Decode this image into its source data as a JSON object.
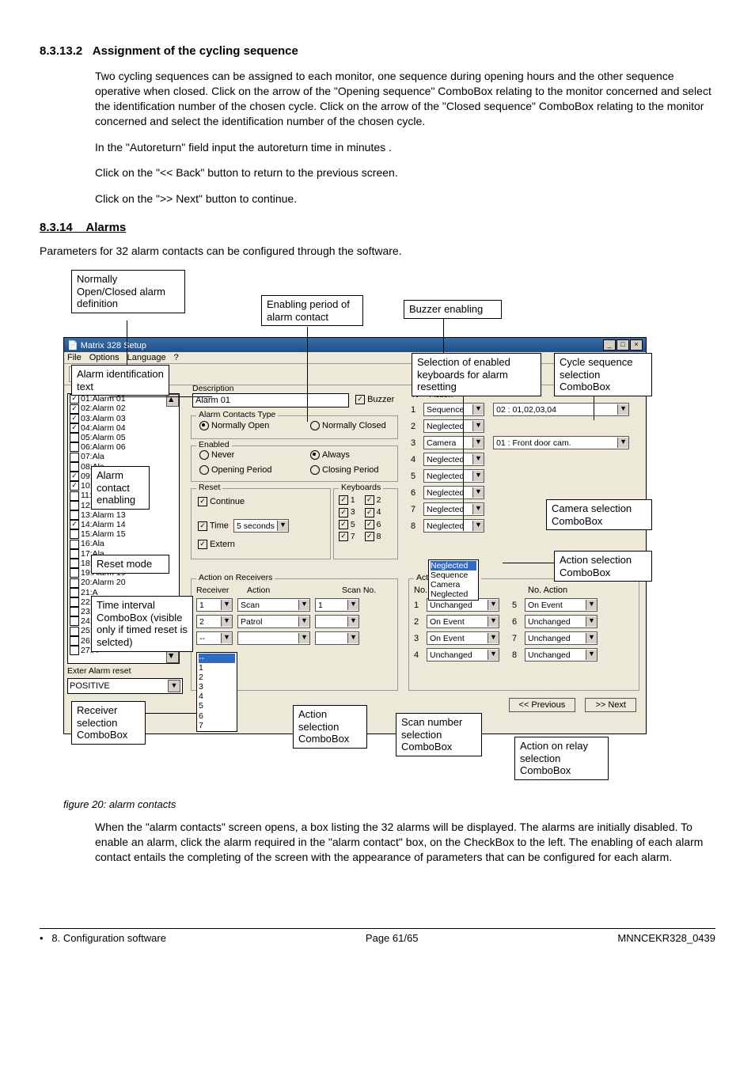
{
  "section": {
    "num1": "8.3.13.2",
    "title1": "Assignment of the cycling sequence",
    "para1": "Two cycling sequences can be assigned to each monitor, one sequence during opening hours and the other sequence operative when closed. Click on the arrow of  the \"Opening sequence\" ComboBox relating to the monitor concerned and select the identification number of the chosen cycle. Click on the arrow of the \"Closed sequence\" ComboBox relating to the monitor concerned and select the identification number of the chosen cycle.",
    "para2": "In the \"Autoreturn\" field input the autoreturn time in minutes .",
    "para3": "Click on the \"<<  Back\" button to return to the previous screen.",
    "para4": "Click on the \">>  Next\" button to continue.",
    "num2": "8.3.14",
    "title2": "Alarms",
    "para5": "Parameters for 32 alarm contacts can be configured through the software."
  },
  "callouts": {
    "c_open_closed": "Normally Open/Closed alarm definition",
    "c_enable_period": "Enabling period of alarm contact",
    "c_buzzer": "Buzzer enabling",
    "c_ident": "Alarm identification text",
    "c_kb_sel": "Selection of enabled keyboards for alarm resetting",
    "c_cycle": "Cycle sequence selection ComboBox",
    "c_alarm_enable": "Alarm contact enabling",
    "c_reset_mode": "Reset mode",
    "c_time_int": "Time interval ComboBox (visible only if timed reset is selcted)",
    "c_cam_sel": "Camera selection ComboBox",
    "c_act_sel": "Action selection ComboBox",
    "c_recv_sel": "Receiver selection ComboBox",
    "c_action_combo": "Action selection ComboBox",
    "c_scan_combo": "Scan number selection ComboBox",
    "c_relay_combo": "Action on relay selection ComboBox"
  },
  "window": {
    "title": "Matrix 328 Setup",
    "menu": [
      "File",
      "Options",
      "Language",
      "?"
    ],
    "desc_label": "Description",
    "desc_value": "Alarm 01",
    "buzzer_label": "Buzzer",
    "alarm_contacts_legend": "Alarm Contacts Type",
    "normally_open": "Normally Open",
    "normally_closed": "Normally Closed",
    "enabled_legend": "Enabled",
    "never": "Never",
    "always": "Always",
    "opening_period": "Opening Period",
    "closing_period": "Closing Period",
    "reset_legend": "Reset",
    "continue": "Continue",
    "time_label": "Time",
    "time_value": "5 seconds",
    "extern": "Extern",
    "keyboards_legend": "Keyboards",
    "kb": [
      "1",
      "2",
      "3",
      "4",
      "5",
      "6",
      "7",
      "8"
    ],
    "n_col": "N°",
    "action_col": "Action",
    "actions_header": {
      "rows": [
        "1",
        "2",
        "3",
        "4",
        "5",
        "6",
        "7",
        "8"
      ]
    },
    "action_vals": [
      "Sequence",
      "Neglected",
      "Camera",
      "Neglected",
      "Neglected",
      "Neglected",
      "Neglected",
      "Neglected"
    ],
    "right_vals": [
      "02 : 01,02,03,04",
      "",
      "01 : Front door cam.",
      "",
      "",
      "",
      "",
      ""
    ],
    "dropdown_open": [
      "Neglected",
      "Sequence",
      "Camera",
      "Neglected"
    ],
    "aor_legend": "Action on Receivers",
    "aor_rec": "Receiver",
    "aor_act": "Action",
    "aor_scan": "Scan No.",
    "aor_rows": [
      {
        "r": "1",
        "a": "Scan",
        "s": "1"
      },
      {
        "r": "2",
        "a": "Patrol",
        "s": ""
      },
      {
        "r": "--",
        "a": "",
        "s": ""
      }
    ],
    "recv_list_items": [
      "--",
      "1",
      "2",
      "3",
      "4",
      "5",
      "6",
      "7"
    ],
    "relay_legend": "Action on Relays",
    "relay_no": "No.",
    "relay_act": "Action",
    "relays": [
      {
        "n": "1",
        "a": "Unchanged"
      },
      {
        "n": "2",
        "a": "On Event"
      },
      {
        "n": "3",
        "a": "On Event"
      },
      {
        "n": "4",
        "a": "Unchanged"
      },
      {
        "n": "5",
        "a": "On Event"
      },
      {
        "n": "6",
        "a": "Unchanged"
      },
      {
        "n": "7",
        "a": "Unchanged"
      },
      {
        "n": "8",
        "a": "Unchanged"
      }
    ],
    "ext_reset": "Exter Alarm reset",
    "positive": "POSITIVE",
    "prev_btn": "<< Previous",
    "next_btn": ">> Next",
    "alarm_list": [
      {
        "c": true,
        "t": "01:Alarm 01"
      },
      {
        "c": true,
        "t": "02:Alarm 02"
      },
      {
        "c": true,
        "t": "03:Alarm 03"
      },
      {
        "c": true,
        "t": "04:Alarm 04"
      },
      {
        "c": false,
        "t": "05:Alarm 05"
      },
      {
        "c": false,
        "t": "06:Alarm 06"
      },
      {
        "c": false,
        "t": "07:Ala"
      },
      {
        "c": false,
        "t": "08:Ala"
      },
      {
        "c": true,
        "t": "09:Ala"
      },
      {
        "c": true,
        "t": "10:Ala"
      },
      {
        "c": false,
        "t": "11:Alarm 11"
      },
      {
        "c": false,
        "t": "12:Alarm 12"
      },
      {
        "c": false,
        "t": "13:Alarm 13"
      },
      {
        "c": true,
        "t": "14:Alarm 14"
      },
      {
        "c": false,
        "t": "15:Alarm 15"
      },
      {
        "c": false,
        "t": "16:Ala"
      },
      {
        "c": false,
        "t": "17:Ala"
      },
      {
        "c": false,
        "t": "18:Alarm 18"
      },
      {
        "c": false,
        "t": "19:Alarm 19"
      },
      {
        "c": false,
        "t": "20:Alarm 20"
      },
      {
        "c": false,
        "t": "21:A"
      },
      {
        "c": false,
        "t": "22:A"
      },
      {
        "c": false,
        "t": "23:A"
      },
      {
        "c": false,
        "t": "24:A"
      },
      {
        "c": false,
        "t": "25:A"
      },
      {
        "c": false,
        "t": "26:A"
      },
      {
        "c": false,
        "t": "27:A"
      }
    ]
  },
  "figure_caption": "figure 20: alarm contacts",
  "post_para": "When the \"alarm contacts\" screen opens, a box listing the 32 alarms will be displayed. The alarms are initially disabled. To enable an alarm, click the alarm required in the \"alarm contact\" box, on the CheckBox to the left. The enabling of each alarm contact entails the completing of the screen with the appearance of parameters that can be configured for each alarm.",
  "footer": {
    "left_bullet": "•",
    "left": "8. Configuration software",
    "center": "Page 61/65",
    "right": "MNNCEKR328_0439"
  }
}
